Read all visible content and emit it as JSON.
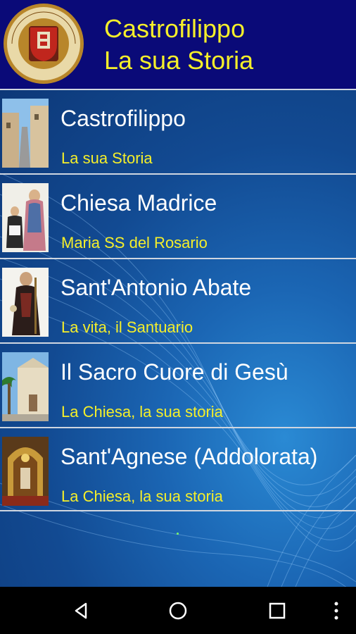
{
  "header": {
    "title_line1": "Castrofilippo",
    "title_line2": "La sua Storia",
    "logo": {
      "icon": "castrum-philippi-seal",
      "text": "CASTRUM PHILIPPI · A. D. 1573"
    }
  },
  "list": [
    {
      "title": "Castrofilippo",
      "subtitle": "La sua Storia",
      "thumb_icon": "street-photo"
    },
    {
      "title": "Chiesa Madrice",
      "subtitle": "Maria SS del Rosario",
      "thumb_icon": "madonna-statue-photo"
    },
    {
      "title": "Sant'Antonio Abate",
      "subtitle": "La vita, il Santuario",
      "thumb_icon": "saint-statue-photo"
    },
    {
      "title": "Il Sacro Cuore di Gesù",
      "subtitle": "La Chiesa, la sua storia",
      "thumb_icon": "church-facade-photo"
    },
    {
      "title": "Sant'Agnese (Addolorata)",
      "subtitle": "La Chiesa, la sua storia",
      "thumb_icon": "church-interior-photo"
    }
  ],
  "navbar": {
    "icons": [
      "back-icon",
      "home-icon",
      "recents-icon",
      "overflow-menu-icon"
    ]
  },
  "colors": {
    "header_bg": "#0a0a78",
    "accent_yellow": "#f5ef2a",
    "list_bg": "#1b66b4",
    "divider": "#cfd6e0"
  }
}
